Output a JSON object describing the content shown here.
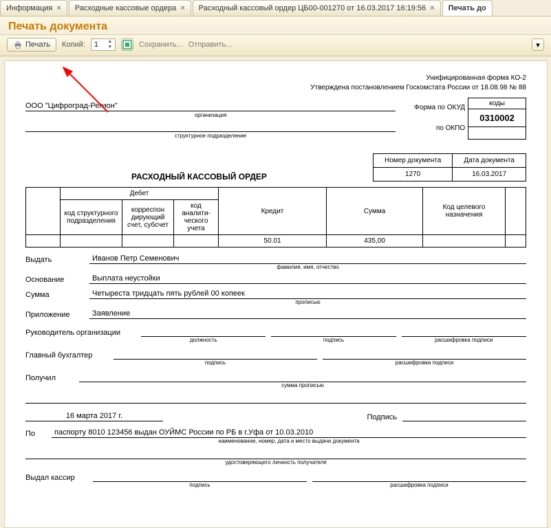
{
  "tabs": {
    "info": "Информация",
    "journal": "Расходные кассовые ордера",
    "doc": "Расходный кассовый ордер ЦБ00-001270 от 16.03.2017 16:19:56",
    "print": "Печать до"
  },
  "title": "Печать документа",
  "toolbar": {
    "print_label": "Печать",
    "copies_label": "Копий:",
    "copies_value": "1",
    "save_label": "Сохранить...",
    "send_label": "Отправить..."
  },
  "form_header": {
    "form_line1": "Унифицированная форма КО-2",
    "form_line2": "Утверждена постановлением Госкомстата России от 18.08.98 № 88",
    "codes_label": "коды",
    "okud_label": "Форма по ОКУД",
    "okud_code": "0310002",
    "okpo_label": "по ОКПО",
    "okpo_code": " "
  },
  "org": {
    "name": "ООО \"Цифроград-Регион\"",
    "org_sub": "организация",
    "dept_sub": "структурное подразделение"
  },
  "doc_title": "РАСХОДНЫЙ КАССОВЫЙ ОРДЕР",
  "doc_num_header": "Номер документа",
  "doc_date_header": "Дата документа",
  "doc_num": "1270",
  "doc_date": "16.03.2017",
  "table": {
    "debit": "Дебет",
    "struct_code": "код структурного подразделения",
    "corr_acc": "корреспон дирующий счет, субсчет",
    "anal_code": "код аналити- ческого учета",
    "credit": "Кредит",
    "sum": "Сумма",
    "target_code": "Код целевого назначения",
    "row": {
      "struct_code": "",
      "corr_acc": "",
      "anal_code": "",
      "credit": "50.01",
      "sum": "435,00",
      "target_code": ""
    }
  },
  "fields": {
    "issue_lbl": "Выдать",
    "issue_val": "Иванов Петр Семенович",
    "issue_sub": "фамилия, имя, отчество",
    "basis_lbl": "Основание",
    "basis_val": "Выплата неустойки",
    "sum_lbl": "Сумма",
    "sum_val": "Четыреста тридцать пять рублей 00 копеек",
    "sum_sub": "прописью",
    "attach_lbl": "Приложение",
    "attach_val": "Заявление",
    "head_lbl": "Руководитель организации",
    "head_sub_pos": "должность",
    "sign_sub": "подпись",
    "decode_sub": "расшифровка подписи",
    "chief_acc_lbl": "Главный бухгалтер",
    "received_lbl": "Получил",
    "received_sub": "сумма прописью",
    "date_val": "16 марта 2017 г.",
    "sign_lbl": "Подпись",
    "by_lbl": "По",
    "passport_val": "паспорту 8010 123456 выдан ОУЙМС России по РБ в г.Уфа от 10.03.2010",
    "passport_sub": "наименование, номер, дата и место выдачи документа",
    "id_sub": "удостоверяющего личность получателя",
    "cashier_lbl": "Выдал кассир"
  }
}
